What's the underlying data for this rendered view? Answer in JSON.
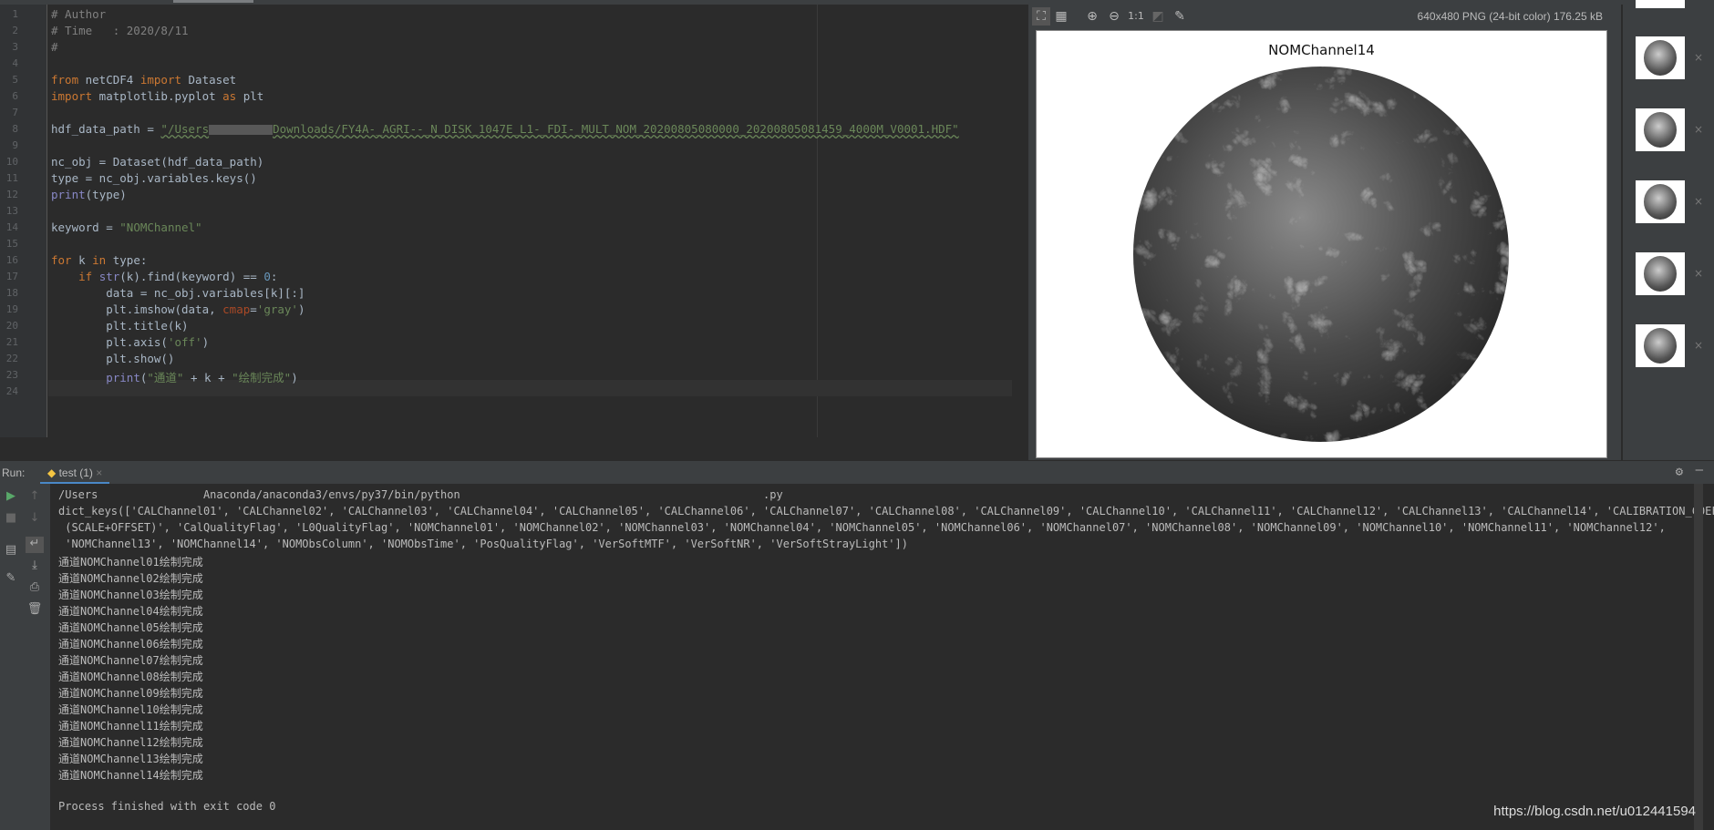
{
  "editor": {
    "lines": [
      {
        "n": "1",
        "html": "<span class='cm'># Author</span>"
      },
      {
        "n": "2",
        "html": "<span class='cm'># Time   : 2020/8/11</span>"
      },
      {
        "n": "3",
        "html": "<span class='cm'>#</span>"
      },
      {
        "n": "4",
        "html": ""
      },
      {
        "n": "5",
        "html": "<span class='kw'>from</span> netCDF4 <span class='kw'>import</span> Dataset"
      },
      {
        "n": "6",
        "html": "<span class='kw'>import</span> matplotlib.pyplot <span class='kw'>as</span> plt"
      },
      {
        "n": "7",
        "html": ""
      },
      {
        "n": "8",
        "html": "hdf_data_path = <span class='str u'>\"/Users<span class='blur' style='width:70px'></span>Downloads/FY4A-_AGRI--_N_DISK_1047E_L1-_FDI-_MULT_NOM_20200805080000_20200805081459_4000M_V0001.HDF\"</span>"
      },
      {
        "n": "9",
        "html": ""
      },
      {
        "n": "10",
        "html": "nc_obj = Dataset(hdf_data_path)"
      },
      {
        "n": "11",
        "html": "type = nc_obj.variables.keys()"
      },
      {
        "n": "12",
        "html": "<span class='bi'>print</span>(type)"
      },
      {
        "n": "13",
        "html": ""
      },
      {
        "n": "14",
        "html": "keyword = <span class='str'>\"NOMChannel\"</span>"
      },
      {
        "n": "15",
        "html": ""
      },
      {
        "n": "16",
        "html": "<span class='kw'>for</span> k <span class='kw'>in</span> type:"
      },
      {
        "n": "17",
        "html": "    <span class='kw'>if</span> <span class='bi'>str</span>(k).find(keyword) == <span class='num'>0</span>:"
      },
      {
        "n": "18",
        "html": "        data = nc_obj.variables[k][:]"
      },
      {
        "n": "19",
        "html": "        plt.imshow(data, <span class='par'>cmap</span>=<span class='str'>'gray'</span>)"
      },
      {
        "n": "20",
        "html": "        plt.title(k)"
      },
      {
        "n": "21",
        "html": "        plt.axis(<span class='str'>'off'</span>)"
      },
      {
        "n": "22",
        "html": "        plt.show()"
      },
      {
        "n": "23",
        "html": "        <span class='bi'>print</span>(<span class='str'>\"通道\"</span> + k + <span class='str'>\"绘制完成\"</span>)"
      },
      {
        "n": "24",
        "html": ""
      }
    ]
  },
  "viewer": {
    "info": "640x480 PNG (24-bit color) 176.25 kB",
    "zoom_actual_label": "1:1",
    "image_title": "NOMChannel14",
    "thumb_close": "×"
  },
  "run": {
    "label": "Run:",
    "tab": "test (1)",
    "tab_close": "×",
    "console": [
      "/Users                Anaconda/anaconda3/envs/py37/bin/python                                              .py",
      "dict_keys(['CALChannel01', 'CALChannel02', 'CALChannel03', 'CALChannel04', 'CALChannel05', 'CALChannel06', 'CALChannel07', 'CALChannel08', 'CALChannel09', 'CALChannel10', 'CALChannel11', 'CALChannel12', 'CALChannel13', 'CALChannel14', 'CALIBRATION_COEF",
      " (SCALE+OFFSET)', 'CalQualityFlag', 'L0QualityFlag', 'NOMChannel01', 'NOMChannel02', 'NOMChannel03', 'NOMChannel04', 'NOMChannel05', 'NOMChannel06', 'NOMChannel07', 'NOMChannel08', 'NOMChannel09', 'NOMChannel10', 'NOMChannel11', 'NOMChannel12',",
      " 'NOMChannel13', 'NOMChannel14', 'NOMObsColumn', 'NOMObsTime', 'PosQualityFlag', 'VerSoftMTF', 'VerSoftNR', 'VerSoftStrayLight'])",
      "通道NOMChannel01绘制完成",
      "通道NOMChannel02绘制完成",
      "通道NOMChannel03绘制完成",
      "通道NOMChannel04绘制完成",
      "通道NOMChannel05绘制完成",
      "通道NOMChannel06绘制完成",
      "通道NOMChannel07绘制完成",
      "通道NOMChannel08绘制完成",
      "通道NOMChannel09绘制完成",
      "通道NOMChannel10绘制完成",
      "通道NOMChannel11绘制完成",
      "通道NOMChannel12绘制完成",
      "通道NOMChannel13绘制完成",
      "通道NOMChannel14绘制完成",
      "",
      "Process finished with exit code 0"
    ]
  },
  "watermark": "https://blog.csdn.net/u012441594"
}
